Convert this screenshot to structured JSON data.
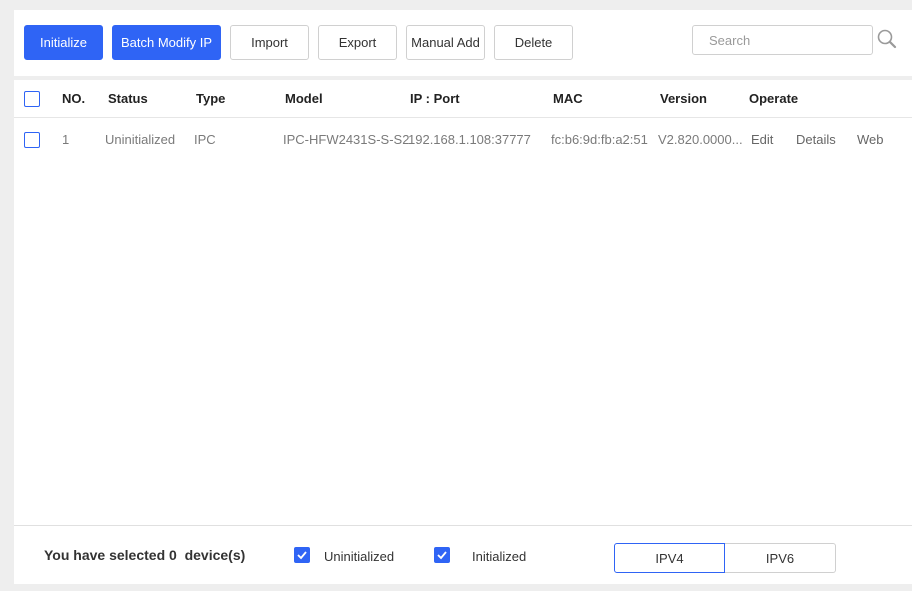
{
  "toolbar": {
    "initialize": "Initialize",
    "batch_modify_ip": "Batch Modify IP",
    "import": "Import",
    "export": "Export",
    "manual_add": "Manual Add",
    "delete": "Delete",
    "search_placeholder": "Search"
  },
  "table": {
    "headers": {
      "no": "NO.",
      "status": "Status",
      "type": "Type",
      "model": "Model",
      "ip_port": "IP : Port",
      "mac": "MAC",
      "version": "Version",
      "operate": "Operate"
    },
    "rows": [
      {
        "no": "1",
        "status": "Uninitialized",
        "type": "IPC",
        "model": "IPC-HFW2431S-S-S2",
        "ip_port": "192.168.1.108:37777",
        "mac": "fc:b6:9d:fb:a2:51",
        "version": "V2.820.0000...",
        "ops": {
          "edit": "Edit",
          "details": "Details",
          "web": "Web"
        }
      }
    ]
  },
  "footer": {
    "selected_text": "You have selected 0  device(s)",
    "filter_uninitialized": "Uninitialized",
    "filter_initialized": "Initialized",
    "ipv4": "IPV4",
    "ipv6": "IPV6"
  },
  "colors": {
    "accent": "#2f64f5",
    "background": "#eeeeee"
  }
}
